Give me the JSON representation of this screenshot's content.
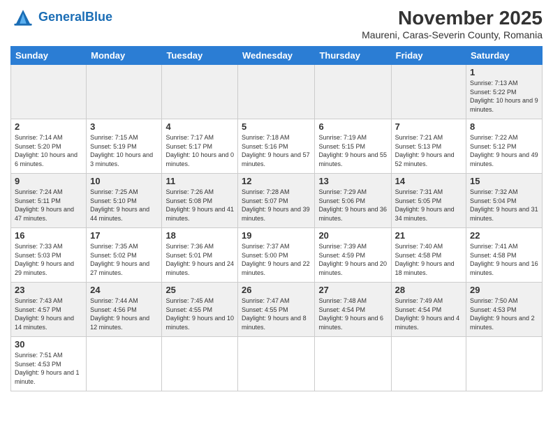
{
  "header": {
    "logo_general": "General",
    "logo_blue": "Blue",
    "month_title": "November 2025",
    "location": "Maureni, Caras-Severin County, Romania"
  },
  "days_of_week": [
    "Sunday",
    "Monday",
    "Tuesday",
    "Wednesday",
    "Thursday",
    "Friday",
    "Saturday"
  ],
  "weeks": [
    [
      {
        "day": "",
        "info": ""
      },
      {
        "day": "",
        "info": ""
      },
      {
        "day": "",
        "info": ""
      },
      {
        "day": "",
        "info": ""
      },
      {
        "day": "",
        "info": ""
      },
      {
        "day": "",
        "info": ""
      },
      {
        "day": "1",
        "info": "Sunrise: 7:13 AM\nSunset: 5:22 PM\nDaylight: 10 hours and 9 minutes."
      }
    ],
    [
      {
        "day": "2",
        "info": "Sunrise: 7:14 AM\nSunset: 5:20 PM\nDaylight: 10 hours and 6 minutes."
      },
      {
        "day": "3",
        "info": "Sunrise: 7:15 AM\nSunset: 5:19 PM\nDaylight: 10 hours and 3 minutes."
      },
      {
        "day": "4",
        "info": "Sunrise: 7:17 AM\nSunset: 5:17 PM\nDaylight: 10 hours and 0 minutes."
      },
      {
        "day": "5",
        "info": "Sunrise: 7:18 AM\nSunset: 5:16 PM\nDaylight: 9 hours and 57 minutes."
      },
      {
        "day": "6",
        "info": "Sunrise: 7:19 AM\nSunset: 5:15 PM\nDaylight: 9 hours and 55 minutes."
      },
      {
        "day": "7",
        "info": "Sunrise: 7:21 AM\nSunset: 5:13 PM\nDaylight: 9 hours and 52 minutes."
      },
      {
        "day": "8",
        "info": "Sunrise: 7:22 AM\nSunset: 5:12 PM\nDaylight: 9 hours and 49 minutes."
      }
    ],
    [
      {
        "day": "9",
        "info": "Sunrise: 7:24 AM\nSunset: 5:11 PM\nDaylight: 9 hours and 47 minutes."
      },
      {
        "day": "10",
        "info": "Sunrise: 7:25 AM\nSunset: 5:10 PM\nDaylight: 9 hours and 44 minutes."
      },
      {
        "day": "11",
        "info": "Sunrise: 7:26 AM\nSunset: 5:08 PM\nDaylight: 9 hours and 41 minutes."
      },
      {
        "day": "12",
        "info": "Sunrise: 7:28 AM\nSunset: 5:07 PM\nDaylight: 9 hours and 39 minutes."
      },
      {
        "day": "13",
        "info": "Sunrise: 7:29 AM\nSunset: 5:06 PM\nDaylight: 9 hours and 36 minutes."
      },
      {
        "day": "14",
        "info": "Sunrise: 7:31 AM\nSunset: 5:05 PM\nDaylight: 9 hours and 34 minutes."
      },
      {
        "day": "15",
        "info": "Sunrise: 7:32 AM\nSunset: 5:04 PM\nDaylight: 9 hours and 31 minutes."
      }
    ],
    [
      {
        "day": "16",
        "info": "Sunrise: 7:33 AM\nSunset: 5:03 PM\nDaylight: 9 hours and 29 minutes."
      },
      {
        "day": "17",
        "info": "Sunrise: 7:35 AM\nSunset: 5:02 PM\nDaylight: 9 hours and 27 minutes."
      },
      {
        "day": "18",
        "info": "Sunrise: 7:36 AM\nSunset: 5:01 PM\nDaylight: 9 hours and 24 minutes."
      },
      {
        "day": "19",
        "info": "Sunrise: 7:37 AM\nSunset: 5:00 PM\nDaylight: 9 hours and 22 minutes."
      },
      {
        "day": "20",
        "info": "Sunrise: 7:39 AM\nSunset: 4:59 PM\nDaylight: 9 hours and 20 minutes."
      },
      {
        "day": "21",
        "info": "Sunrise: 7:40 AM\nSunset: 4:58 PM\nDaylight: 9 hours and 18 minutes."
      },
      {
        "day": "22",
        "info": "Sunrise: 7:41 AM\nSunset: 4:58 PM\nDaylight: 9 hours and 16 minutes."
      }
    ],
    [
      {
        "day": "23",
        "info": "Sunrise: 7:43 AM\nSunset: 4:57 PM\nDaylight: 9 hours and 14 minutes."
      },
      {
        "day": "24",
        "info": "Sunrise: 7:44 AM\nSunset: 4:56 PM\nDaylight: 9 hours and 12 minutes."
      },
      {
        "day": "25",
        "info": "Sunrise: 7:45 AM\nSunset: 4:55 PM\nDaylight: 9 hours and 10 minutes."
      },
      {
        "day": "26",
        "info": "Sunrise: 7:47 AM\nSunset: 4:55 PM\nDaylight: 9 hours and 8 minutes."
      },
      {
        "day": "27",
        "info": "Sunrise: 7:48 AM\nSunset: 4:54 PM\nDaylight: 9 hours and 6 minutes."
      },
      {
        "day": "28",
        "info": "Sunrise: 7:49 AM\nSunset: 4:54 PM\nDaylight: 9 hours and 4 minutes."
      },
      {
        "day": "29",
        "info": "Sunrise: 7:50 AM\nSunset: 4:53 PM\nDaylight: 9 hours and 2 minutes."
      }
    ],
    [
      {
        "day": "30",
        "info": "Sunrise: 7:51 AM\nSunset: 4:53 PM\nDaylight: 9 hours and 1 minute."
      },
      {
        "day": "",
        "info": ""
      },
      {
        "day": "",
        "info": ""
      },
      {
        "day": "",
        "info": ""
      },
      {
        "day": "",
        "info": ""
      },
      {
        "day": "",
        "info": ""
      },
      {
        "day": "",
        "info": ""
      }
    ]
  ]
}
